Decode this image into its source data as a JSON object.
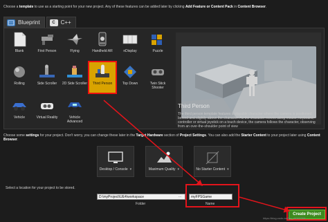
{
  "intro": {
    "part1": "Choose a ",
    "bold1": "template",
    "part2": " to use as a starting point for your new project.  Any of these features can be added later by clicking ",
    "bold2": "Add Feature or Content Pack",
    "part3": " in ",
    "bold3": "Content Browser",
    "part4": "."
  },
  "tabs": [
    {
      "label": "Blueprint",
      "active": true
    },
    {
      "label": "C++",
      "active": false
    }
  ],
  "templates": [
    {
      "label": "Blank",
      "icon": "blank-icon"
    },
    {
      "label": "First Person",
      "icon": "first-person-icon"
    },
    {
      "label": "Flying",
      "icon": "flying-icon"
    },
    {
      "label": "Handheld AR",
      "icon": "handheld-ar-icon"
    },
    {
      "label": "nDisplay",
      "icon": "ndisplay-icon"
    },
    {
      "label": "Puzzle",
      "icon": "puzzle-icon"
    },
    {
      "label": "Rolling",
      "icon": "rolling-icon"
    },
    {
      "label": "Side Scroller",
      "icon": "side-scroller-icon"
    },
    {
      "label": "2D Side Scroller",
      "icon": "2d-side-scroller-icon"
    },
    {
      "label": "Third Person",
      "icon": "third-person-icon",
      "selected": true
    },
    {
      "label": "Top Down",
      "icon": "top-down-icon"
    },
    {
      "label": "Twin Stick Shooter",
      "icon": "twin-stick-icon"
    },
    {
      "label": "Vehicle",
      "icon": "vehicle-icon"
    },
    {
      "label": "Virtual Reality",
      "icon": "vr-icon"
    },
    {
      "label": "Vehicle Advanced",
      "icon": "vehicle-advanced-icon"
    }
  ],
  "preview": {
    "title": "Third Person",
    "description": "The third person template features a playable character where the camera is positioned behind and slightly above the character. As the character moves using mouse, keyboard, controller or virtual joystick on a touch device, the camera follows the character, observing from an over-the-shoulder point of view"
  },
  "settings_intro": {
    "part1": "Choose some ",
    "bold1": "settings",
    "part2": " for your project.  Don't worry, you can change these later in the ",
    "bold2": "Target Hardware",
    "part3": " section of ",
    "bold3": "Project Settings",
    "part4": ".  You can also add the ",
    "bold4": "Starter Content",
    "part5": " to your project later using ",
    "bold5": "Content Browser",
    "part6": "."
  },
  "options": [
    {
      "label": "Desktop / Console",
      "icon": "monitor-icon"
    },
    {
      "label": "Maximum Quality",
      "icon": "quality-icon"
    },
    {
      "label": "No Starter Content",
      "icon": "no-content-icon"
    }
  ],
  "location": {
    "label": "Select a location for your project to be stored.",
    "folder_value": "D:\\myProject\\UE4\\workspace",
    "browse": "...",
    "folder_caption": "Folder",
    "name_value": "myFPSGame",
    "name_caption": "Name"
  },
  "create_button": "Create Project",
  "watermark": "https://blog.csdn.net/qq_46365308",
  "colors": {
    "accent_selected": "#d9a300",
    "annotation_red": "#e3141b",
    "create_green": "#3d8b1f"
  }
}
